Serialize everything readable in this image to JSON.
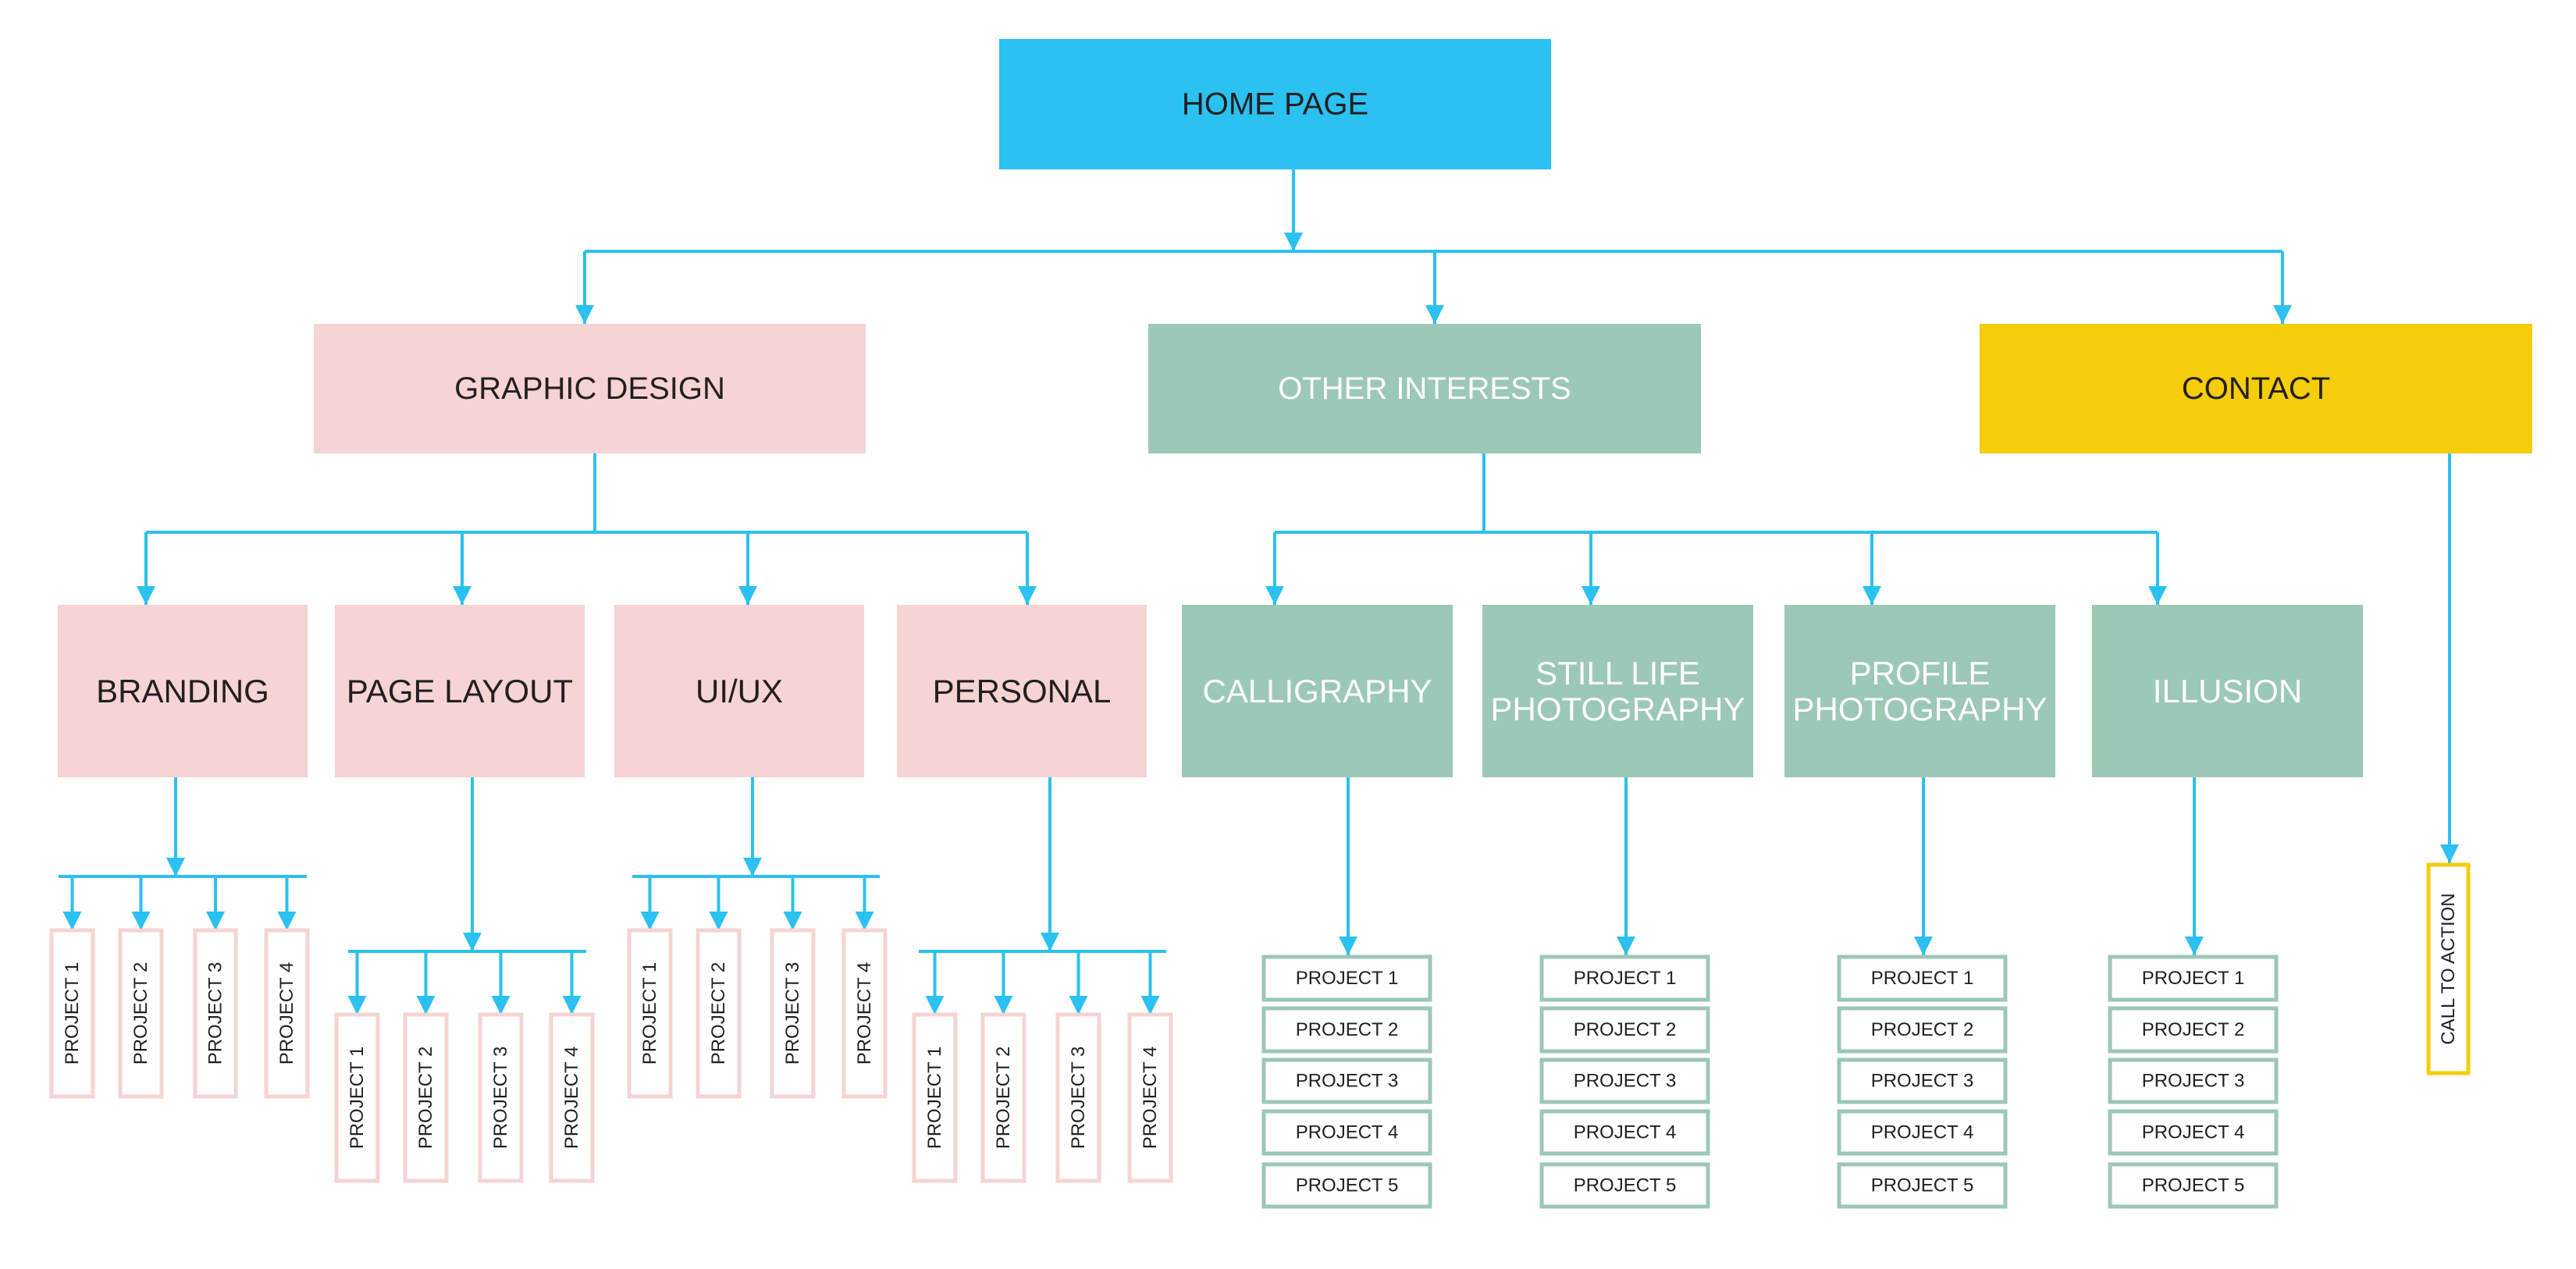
{
  "colors": {
    "connector": "#2BC1F0",
    "home": "#2BC1F0",
    "graphic_design": "#F5D4D3",
    "other_interests": "#9CC8B6",
    "contact": "#F6CD0B",
    "text_dark": "#231F20",
    "text_light": "#FFFFFF"
  },
  "home": {
    "label": "HOME PAGE"
  },
  "sections": [
    {
      "label": "GRAPHIC DESIGN",
      "children": [
        {
          "label": [
            "BRANDING"
          ],
          "projects": [
            "PROJECT 1",
            "PROJECT 2",
            "PROJECT 3",
            "PROJECT 4"
          ]
        },
        {
          "label": [
            "PAGE LAYOUT"
          ],
          "projects": [
            "PROJECT 1",
            "PROJECT 2",
            "PROJECT 3",
            "PROJECT 4"
          ]
        },
        {
          "label": [
            "UI/UX"
          ],
          "projects": [
            "PROJECT 1",
            "PROJECT 2",
            "PROJECT 3",
            "PROJECT 4"
          ]
        },
        {
          "label": [
            "PERSONAL"
          ],
          "projects": [
            "PROJECT 1",
            "PROJECT 2",
            "PROJECT 3",
            "PROJECT 4"
          ]
        }
      ]
    },
    {
      "label": "OTHER INTERESTS",
      "children": [
        {
          "label": [
            "CALLIGRAPHY"
          ],
          "projects": [
            "PROJECT 1",
            "PROJECT 2",
            "PROJECT 3",
            "PROJECT 4",
            "PROJECT 5"
          ]
        },
        {
          "label": [
            "STILL LIFE",
            "PHOTOGRAPHY"
          ],
          "projects": [
            "PROJECT 1",
            "PROJECT 2",
            "PROJECT 3",
            "PROJECT 4",
            "PROJECT 5"
          ]
        },
        {
          "label": [
            "PROFILE",
            "PHOTOGRAPHY"
          ],
          "projects": [
            "PROJECT 1",
            "PROJECT 2",
            "PROJECT 3",
            "PROJECT 4",
            "PROJECT 5"
          ]
        },
        {
          "label": [
            "ILLUSION"
          ],
          "projects": [
            "PROJECT 1",
            "PROJECT 2",
            "PROJECT 3",
            "PROJECT 4",
            "PROJECT 5"
          ]
        }
      ]
    },
    {
      "label": "CONTACT",
      "children": [],
      "cta": "CALL TO ACTION"
    }
  ]
}
